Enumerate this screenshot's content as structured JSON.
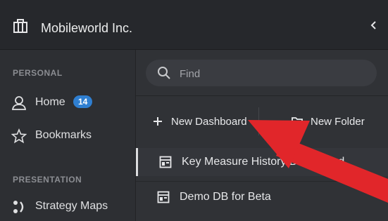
{
  "header": {
    "org_name": "Mobileworld Inc.",
    "org_icon": "briefcase-icon",
    "collapse_icon": "chevron-left-icon"
  },
  "sidebar": {
    "personal_title": "PERSONAL",
    "presentation_title": "PRESENTATION",
    "items": [
      {
        "label": "Home",
        "icon": "user-icon",
        "badge": "14"
      },
      {
        "label": "Bookmarks",
        "icon": "star-icon"
      },
      {
        "label": "Strategy Maps",
        "icon": "strategy-map-icon"
      }
    ]
  },
  "search": {
    "placeholder": "Find",
    "icon": "search-icon"
  },
  "actions": {
    "new_dashboard": "New Dashboard",
    "new_folder": "New Folder"
  },
  "dashboards": [
    {
      "label": "Key Measure History Dashboard",
      "active": true
    },
    {
      "label": "Demo DB for Beta",
      "active": false
    }
  ],
  "annotation": {
    "arrow_color": "#e1262a"
  },
  "colors": {
    "badge": "#2f7fd1",
    "background": "#2b2d31"
  }
}
